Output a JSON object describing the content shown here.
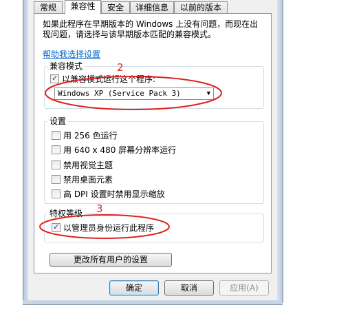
{
  "tabs": [
    "常规",
    "兼容性",
    "安全",
    "详细信息",
    "以前的版本"
  ],
  "active_tab": "兼容性",
  "intro_text": "如果此程序在早期版本的 Windows 上没有问题，而现在出现问题，请选择与该早期版本匹配的兼容模式。",
  "help_link": "帮助我选择设置",
  "compat_group": {
    "label": "兼容模式",
    "checkbox_label": "以兼容模式运行这个程序:",
    "checked": true,
    "select_value": "Windows XP (Service Pack 3)"
  },
  "settings_group": {
    "label": "设置",
    "items": [
      {
        "label": "用 256 色运行",
        "checked": false
      },
      {
        "label": "用 640 x 480 屏幕分辨率运行",
        "checked": false
      },
      {
        "label": "禁用视觉主题",
        "checked": false
      },
      {
        "label": "禁用桌面元素",
        "checked": false
      },
      {
        "label": "高 DPI 设置时禁用显示缩放",
        "checked": false
      }
    ]
  },
  "privilege_group": {
    "label": "特权等级",
    "checkbox_label": "以管理员身份运行此程序",
    "checked": true
  },
  "change_all_button": "更改所有用户的设置",
  "buttons": {
    "ok": "确定",
    "cancel": "取消",
    "apply": "应用(A)"
  },
  "annotations": {
    "n2": "2",
    "n3": "3",
    "color": "#e02020"
  }
}
